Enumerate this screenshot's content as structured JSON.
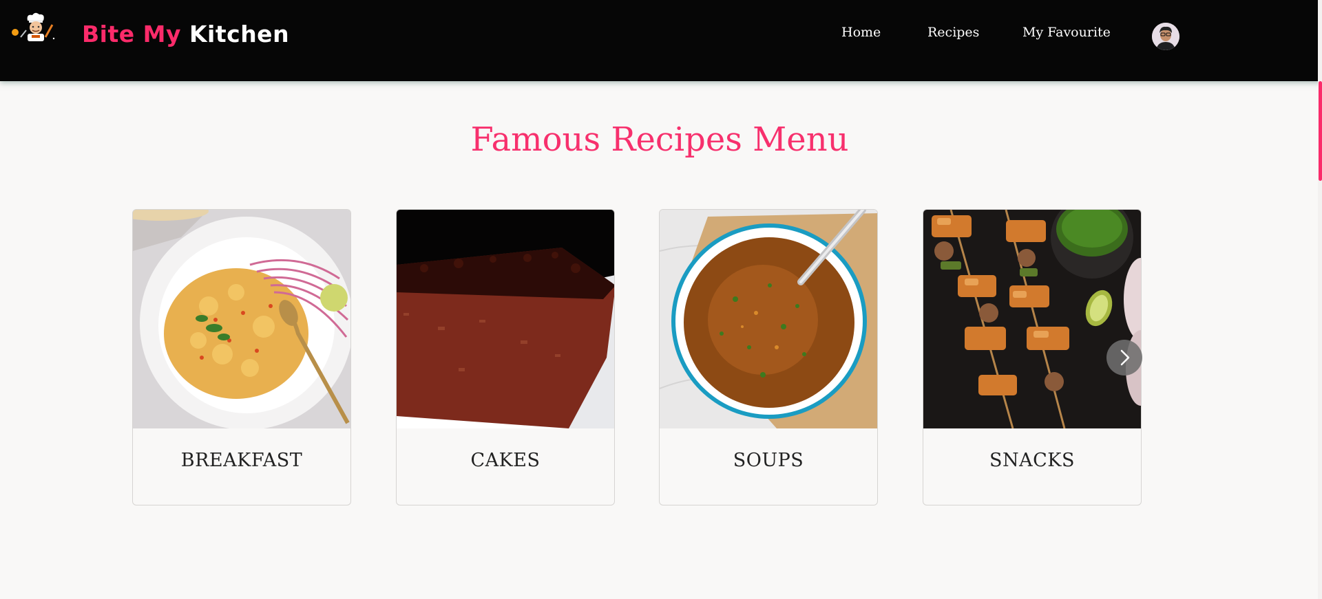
{
  "header": {
    "brand_part1": "Bite My",
    "brand_part2": "Kitchen",
    "nav": [
      "Home",
      "Recipes",
      "My Favourite"
    ]
  },
  "main": {
    "title": "Famous Recipes Menu",
    "categories": [
      {
        "label": "BREAKFAST",
        "image": "egg-bhurji-bowl"
      },
      {
        "label": "CAKES",
        "image": "chocolate-cake-slice"
      },
      {
        "label": "SOUPS",
        "image": "soup-bowl"
      },
      {
        "label": "SNACKS",
        "image": "paneer-tikka-skewers"
      }
    ],
    "next_icon": "chevron-right-icon"
  },
  "colors": {
    "accent": "#fb2b6a",
    "navbar": "#060606",
    "background": "#f9f8f7"
  }
}
